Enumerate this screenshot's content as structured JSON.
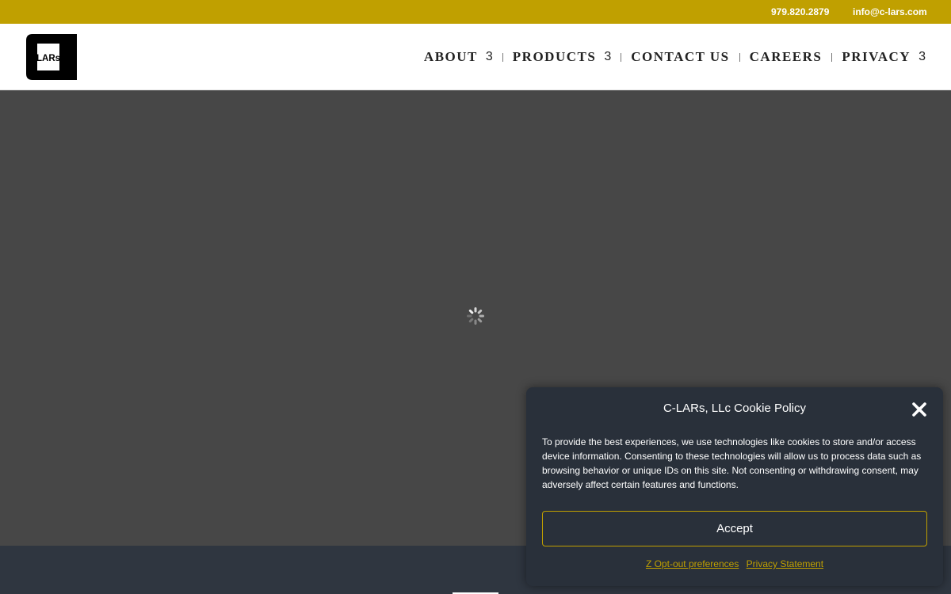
{
  "topbar": {
    "phone": "979.820.2879",
    "email": "info@c-lars.com",
    "background": "#c0a000"
  },
  "header": {
    "logo_text": "LARs",
    "nav": [
      {
        "label": "ABOUT",
        "caret": "3"
      },
      {
        "label": "PRODUCTS",
        "caret": "3"
      },
      {
        "label": "CONTACT US"
      },
      {
        "label": "CAREERS"
      },
      {
        "label": "PRIVACY",
        "caret": "3"
      }
    ]
  },
  "hero": {
    "background": "#474747",
    "loading_icon": "spinner-icon"
  },
  "cookie_banner": {
    "title": "C-LARs, LLc Cookie Policy",
    "close_icon": "close-icon",
    "message": "To provide the best experiences, we use technologies like cookies to store and/or access device information. Consenting to these technologies will allow us to process data such as browsing behavior or unique IDs on this site. Not consenting or withdrawing consent, may adversely affect certain features and functions.",
    "accept_label": "Accept",
    "optout_label": "Z Opt-out preferences",
    "privacy_label": "Privacy Statement",
    "accent": "#c0a000",
    "background": "#29303a"
  },
  "footer": {
    "background": "#2f3640"
  }
}
